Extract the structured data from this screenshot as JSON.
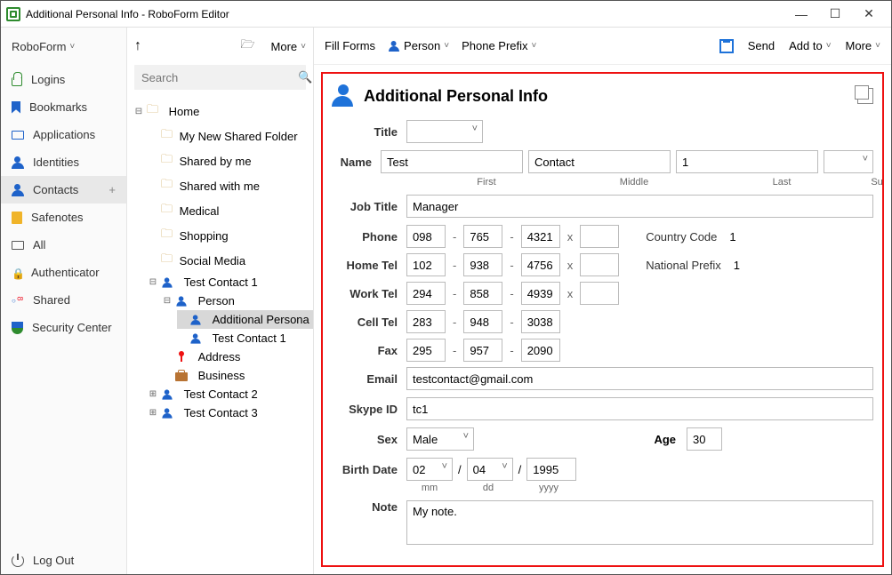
{
  "window": {
    "title": "Additional Personal Info - RoboForm Editor"
  },
  "brand": "RoboForm",
  "leftnav": {
    "items": [
      {
        "label": "Logins",
        "icon": "lock"
      },
      {
        "label": "Bookmarks",
        "icon": "bookmark"
      },
      {
        "label": "Applications",
        "icon": "card"
      },
      {
        "label": "Identities",
        "icon": "person"
      },
      {
        "label": "Contacts",
        "icon": "person",
        "active": true,
        "plus": true
      },
      {
        "label": "Safenotes",
        "icon": "noteY"
      },
      {
        "label": "All",
        "icon": "inbox"
      },
      {
        "label": "Authenticator",
        "icon": "lockA"
      },
      {
        "label": "Shared",
        "icon": "share"
      },
      {
        "label": "Security Center",
        "icon": "sc"
      }
    ],
    "logout": "Log Out"
  },
  "mid": {
    "more": "More",
    "search_placeholder": "Search",
    "tree": {
      "home": "Home",
      "folders": [
        "My New Shared Folder",
        "Shared by me",
        "Shared with me",
        "Medical",
        "Shopping",
        "Social Media"
      ],
      "contact1": "Test Contact 1",
      "person": "Person",
      "additional": "Additional Persona",
      "tc1": "Test Contact 1",
      "address": "Address",
      "business": "Business",
      "contact2": "Test Contact 2",
      "contact3": "Test Contact 3"
    }
  },
  "toolbar": {
    "fill": "Fill Forms",
    "person": "Person",
    "prefix": "Phone Prefix",
    "send": "Send",
    "addto": "Add to",
    "more": "More"
  },
  "form": {
    "heading": "Additional Personal Info",
    "labels": {
      "title": "Title",
      "name": "Name",
      "jobtitle": "Job Title",
      "phone": "Phone",
      "hometel": "Home Tel",
      "worktel": "Work Tel",
      "celltel": "Cell Tel",
      "fax": "Fax",
      "email": "Email",
      "skype": "Skype ID",
      "sex": "Sex",
      "age": "Age",
      "birth": "Birth Date",
      "note": "Note",
      "first": "First",
      "middle": "Middle",
      "last": "Last",
      "suffix": "Suffix",
      "mm": "mm",
      "dd": "dd",
      "yyyy": "yyyy",
      "cc": "Country Code",
      "np": "National Prefix"
    },
    "values": {
      "title": "",
      "first": "Test",
      "middle": "Contact",
      "last": "1",
      "suffix": "",
      "jobtitle": "Manager",
      "phone": [
        "098",
        "765",
        "4321",
        ""
      ],
      "hometel": [
        "102",
        "938",
        "4756",
        ""
      ],
      "worktel": [
        "294",
        "858",
        "4939",
        ""
      ],
      "celltel": [
        "283",
        "948",
        "3038"
      ],
      "fax": [
        "295",
        "957",
        "2090"
      ],
      "email": "testcontact@gmail.com",
      "skype": "tc1",
      "sex": "Male",
      "age": "30",
      "birth": [
        "02",
        "04",
        "1995"
      ],
      "note": "My note.",
      "cc": "1",
      "np": "1"
    }
  }
}
